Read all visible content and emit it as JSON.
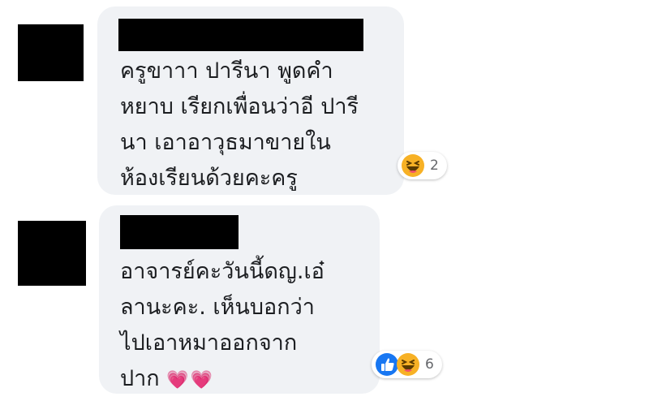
{
  "comments": [
    {
      "text": "ครูขาาา ปารีนา พูดคำ\nหยาบ เรียกเพื่อนว่าอี ปารี\nนา เอาอาวุธมาขายใน\nห้องเรียนด้วยคะครู",
      "reactions": {
        "icons": [
          "haha-icon"
        ],
        "count": "2"
      }
    },
    {
      "text": "อาจารย์คะวันนี้ดญ.เอ๋\nลานะคะ. เห็นบอกว่า\nไปเอาหมาออกจาก\nปาก",
      "emoji": "💗💗",
      "reactions": {
        "icons": [
          "like-icon",
          "haha-icon"
        ],
        "count": "6"
      }
    }
  ],
  "colors": {
    "bubble": "#f0f2f5",
    "text": "#1c1e21",
    "like": "#1877f2",
    "haha": "#f7b125",
    "redaction": "#000000"
  }
}
